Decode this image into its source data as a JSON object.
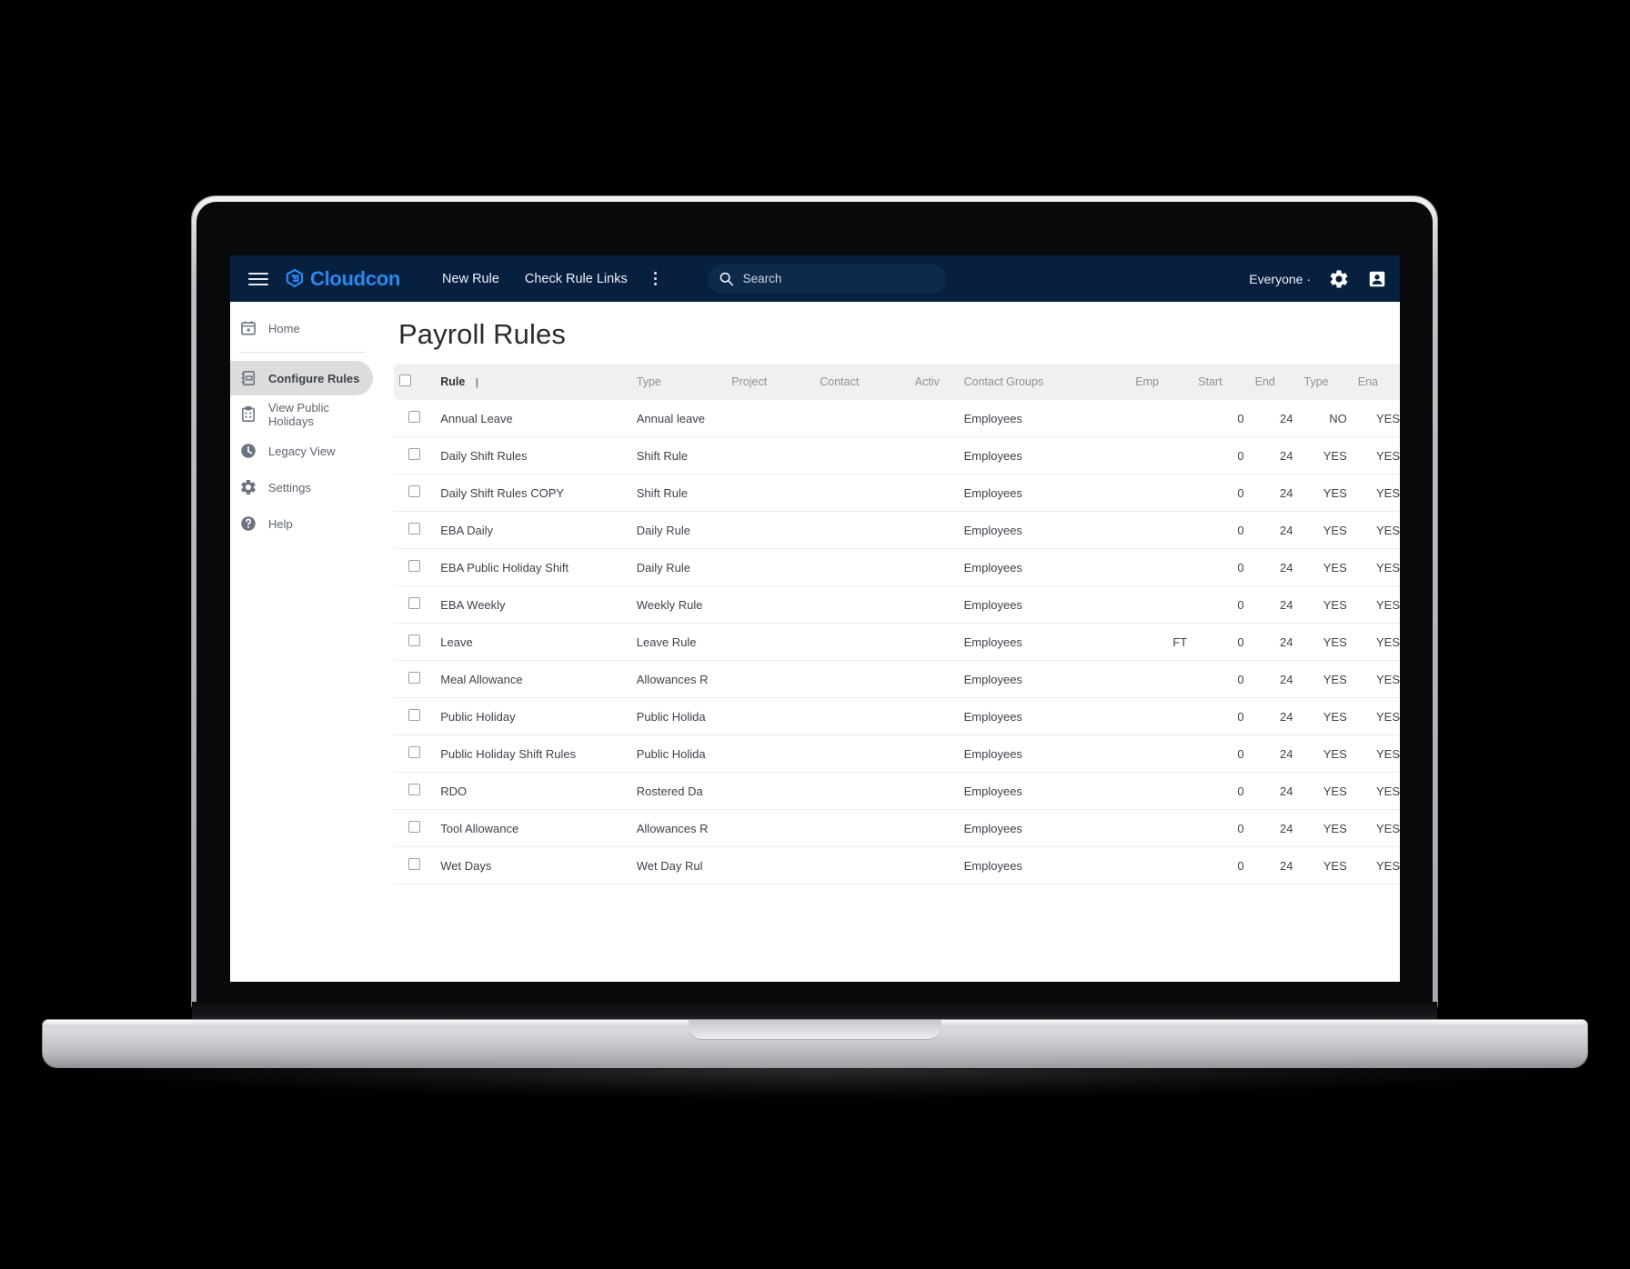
{
  "topbar": {
    "menu_icon": "hamburger-menu-icon",
    "brand": "Cloudcon",
    "brand_logo_icon": "cloudcon-logo-icon",
    "brand_color": "#2b88f0",
    "bar_color": "#07203f",
    "nav": [
      {
        "label": "New Rule"
      },
      {
        "label": "Check Rule Links"
      }
    ],
    "overflow_icon": "kebab-menu-icon",
    "search": {
      "icon": "search-icon",
      "placeholder": "Search",
      "value": ""
    },
    "scope_selector": "Everyone ·",
    "settings_icon": "gear-icon",
    "account_icon": "account-avatar-icon"
  },
  "sidebar": {
    "items": [
      {
        "label": "Home",
        "icon": "calendar-icon",
        "active": false
      },
      {
        "label": "Configure Rules",
        "icon": "rulebook-icon",
        "active": true
      },
      {
        "label": "View Public Holidays",
        "icon": "clipboard-icon",
        "active": false
      },
      {
        "label": "Legacy View",
        "icon": "clock-icon",
        "active": false
      },
      {
        "label": "Settings",
        "icon": "gear-icon",
        "active": false
      },
      {
        "label": "Help",
        "icon": "help-circle-icon",
        "active": false
      }
    ]
  },
  "main": {
    "page_title": "Payroll Rules",
    "table": {
      "sort_column": "Rule",
      "sort_indicator": "|",
      "columns": [
        {
          "key": "select",
          "label": ""
        },
        {
          "key": "rule",
          "label": "Rule"
        },
        {
          "key": "type",
          "label": "Type"
        },
        {
          "key": "project",
          "label": "Project"
        },
        {
          "key": "contact",
          "label": "Contact"
        },
        {
          "key": "activ",
          "label": "Activ"
        },
        {
          "key": "contact_groups",
          "label": "Contact Groups"
        },
        {
          "key": "emp",
          "label": "Emp"
        },
        {
          "key": "start",
          "label": "Start"
        },
        {
          "key": "end",
          "label": "End"
        },
        {
          "key": "type2",
          "label": "Type"
        },
        {
          "key": "ena",
          "label": "Ena"
        }
      ],
      "rows": [
        {
          "rule": "Annual Leave",
          "type": "Annual leave",
          "project": "",
          "contact": "",
          "activ": "",
          "contact_groups": "Employees",
          "emp": "",
          "start": "0",
          "end": "24",
          "type2": "NO",
          "ena": "YES"
        },
        {
          "rule": "Daily Shift Rules",
          "type": "Shift Rule",
          "project": "",
          "contact": "",
          "activ": "",
          "contact_groups": "Employees",
          "emp": "",
          "start": "0",
          "end": "24",
          "type2": "YES",
          "ena": "YES"
        },
        {
          "rule": "Daily Shift Rules COPY",
          "type": "Shift Rule",
          "project": "",
          "contact": "",
          "activ": "",
          "contact_groups": "Employees",
          "emp": "",
          "start": "0",
          "end": "24",
          "type2": "YES",
          "ena": "YES"
        },
        {
          "rule": "EBA Daily",
          "type": "Daily Rule",
          "project": "",
          "contact": "",
          "activ": "",
          "contact_groups": "Employees",
          "emp": "",
          "start": "0",
          "end": "24",
          "type2": "YES",
          "ena": "YES"
        },
        {
          "rule": "EBA Public Holiday Shift",
          "type": "Daily Rule",
          "project": "",
          "contact": "",
          "activ": "",
          "contact_groups": "Employees",
          "emp": "",
          "start": "0",
          "end": "24",
          "type2": "YES",
          "ena": "YES"
        },
        {
          "rule": "EBA Weekly",
          "type": "Weekly Rule",
          "project": "",
          "contact": "",
          "activ": "",
          "contact_groups": "Employees",
          "emp": "",
          "start": "0",
          "end": "24",
          "type2": "YES",
          "ena": "YES"
        },
        {
          "rule": "Leave",
          "type": "Leave Rule",
          "project": "",
          "contact": "",
          "activ": "",
          "contact_groups": "Employees",
          "emp": "FT",
          "start": "0",
          "end": "24",
          "type2": "YES",
          "ena": "YES"
        },
        {
          "rule": "Meal Allowance",
          "type": "Allowances R",
          "project": "",
          "contact": "",
          "activ": "",
          "contact_groups": "Employees",
          "emp": "",
          "start": "0",
          "end": "24",
          "type2": "YES",
          "ena": "YES"
        },
        {
          "rule": "Public Holiday",
          "type": "Public Holida",
          "project": "",
          "contact": "",
          "activ": "",
          "contact_groups": "Employees",
          "emp": "",
          "start": "0",
          "end": "24",
          "type2": "YES",
          "ena": "YES"
        },
        {
          "rule": "Public Holiday Shift Rules",
          "type": "Public Holida",
          "project": "",
          "contact": "",
          "activ": "",
          "contact_groups": "Employees",
          "emp": "",
          "start": "0",
          "end": "24",
          "type2": "YES",
          "ena": "YES"
        },
        {
          "rule": "RDO",
          "type": "Rostered Da",
          "project": "",
          "contact": "",
          "activ": "",
          "contact_groups": "Employees",
          "emp": "",
          "start": "0",
          "end": "24",
          "type2": "YES",
          "ena": "YES"
        },
        {
          "rule": "Tool Allowance",
          "type": "Allowances R",
          "project": "",
          "contact": "",
          "activ": "",
          "contact_groups": "Employees",
          "emp": "",
          "start": "0",
          "end": "24",
          "type2": "YES",
          "ena": "YES"
        },
        {
          "rule": "Wet Days",
          "type": "Wet Day Rul",
          "project": "",
          "contact": "",
          "activ": "",
          "contact_groups": "Employees",
          "emp": "",
          "start": "0",
          "end": "24",
          "type2": "YES",
          "ena": "YES"
        }
      ]
    }
  }
}
